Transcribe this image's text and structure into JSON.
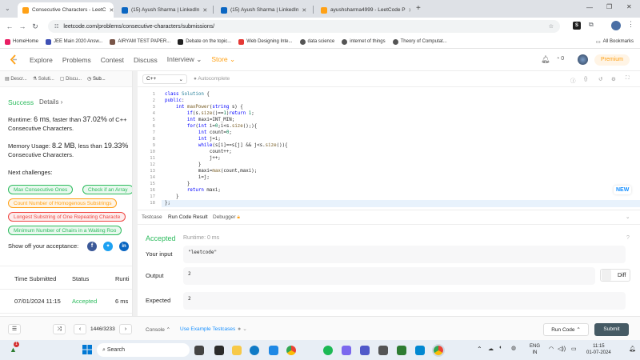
{
  "browser": {
    "tabs": [
      {
        "title": "Consecutive Characters - LeetC",
        "active": true,
        "favicon_color": "#ffa116"
      },
      {
        "title": "(15) Ayush Sharma | LinkedIn",
        "active": false,
        "favicon_color": "#0a66c2"
      },
      {
        "title": "(15) Ayush Sharma | LinkedIn",
        "active": false,
        "favicon_color": "#0a66c2"
      },
      {
        "title": "ayushsharma4999 - LeetCode P",
        "active": false,
        "favicon_color": "#ffa116"
      }
    ],
    "new_tab_label": "+",
    "url": "leetcode.com/problems/consecutive-characters/submissions/",
    "bookmarks": [
      {
        "label": "HomeHome",
        "color": "#e91e63"
      },
      {
        "label": "JEE Main 2020 Answ...",
        "color": "#3f51b5"
      },
      {
        "label": "AIRYAM TEST PAPER...",
        "color": "#795548"
      },
      {
        "label": "Debate on the topic...",
        "color": "#222222"
      },
      {
        "label": "Web Designing Inte...",
        "color": "#e53935"
      },
      {
        "label": "data science",
        "color": "#555555"
      },
      {
        "label": "internet of things",
        "color": "#555555"
      },
      {
        "label": "Theory of Computat...",
        "color": "#555555"
      }
    ],
    "all_bookmarks_label": "All Bookmarks"
  },
  "header": {
    "nav": [
      "Explore",
      "Problems",
      "Contest",
      "Discuss",
      "Interview",
      "Store"
    ],
    "streak_count": "0",
    "premium_label": "Premium"
  },
  "left_tabs": [
    "Descr...",
    "Soluti...",
    "Discu...",
    "Sub..."
  ],
  "result": {
    "status": "Success",
    "details_label": "Details",
    "runtime_prefix": "Runtime:",
    "runtime_value": "6 ms",
    "runtime_suffix": ", faster than",
    "runtime_percent": "37.02%",
    "runtime_tail": "of C++",
    "runtime_tail2": "Consecutive Characters.",
    "memory_prefix": "Memory Usage:",
    "memory_value": "8.2 MB",
    "memory_suffix": ", less than",
    "memory_percent": "19.33%",
    "memory_tail2": "Consecutive Characters.",
    "next_label": "Next challenges:",
    "challenges": [
      {
        "label": "Max Consecutive Ones",
        "color": "g"
      },
      {
        "label": "Check if an Array",
        "color": "g"
      },
      {
        "label": "Count Number of Homogenous Substrings",
        "color": "y"
      },
      {
        "label": "Longest Substring of One Repeating Characte",
        "color": "r"
      },
      {
        "label": "Minimum Number of Chairs in a Waiting Roo",
        "color": "g"
      }
    ],
    "share_label": "Show off your acceptance:",
    "table_headers": [
      "Time Submitted",
      "Status",
      "Runti"
    ],
    "table_row": [
      "07/01/2024 11:15",
      "Accepted",
      "6 ms"
    ]
  },
  "editor": {
    "language": "C++",
    "autocomplete": "Autocomplete",
    "line_numbers": [
      "1",
      "2",
      "3",
      "4",
      "5",
      "6",
      "7",
      "8",
      "9",
      "10",
      "11",
      "12",
      "13",
      "14",
      "15",
      "16",
      "17",
      "18"
    ],
    "new_badge": "NEW"
  },
  "bottom": {
    "tabs": [
      "Testcase",
      "Run Code Result",
      "Debugger"
    ],
    "accepted": "Accepted",
    "runtime": "Runtime: 0 ms",
    "input_label": "Your input",
    "input_value": "\"leetcode\"",
    "output_label": "Output",
    "output_value": "2",
    "expected_label": "Expected",
    "expected_value": "2",
    "diff_label": "Diff"
  },
  "footer": {
    "pager": "1446/3233",
    "console": "Console",
    "use_example": "Use Example Testcases",
    "run_code": "Run Code",
    "submit": "Submit"
  },
  "taskbar": {
    "search": "Search",
    "lang1": "ENG",
    "lang2": "IN",
    "time": "11:15",
    "date": "01-07-2024",
    "notif_count": "1"
  },
  "colors": {
    "accent": "#ffa116",
    "success": "#2cbb5d",
    "blue": "#1890ff"
  }
}
